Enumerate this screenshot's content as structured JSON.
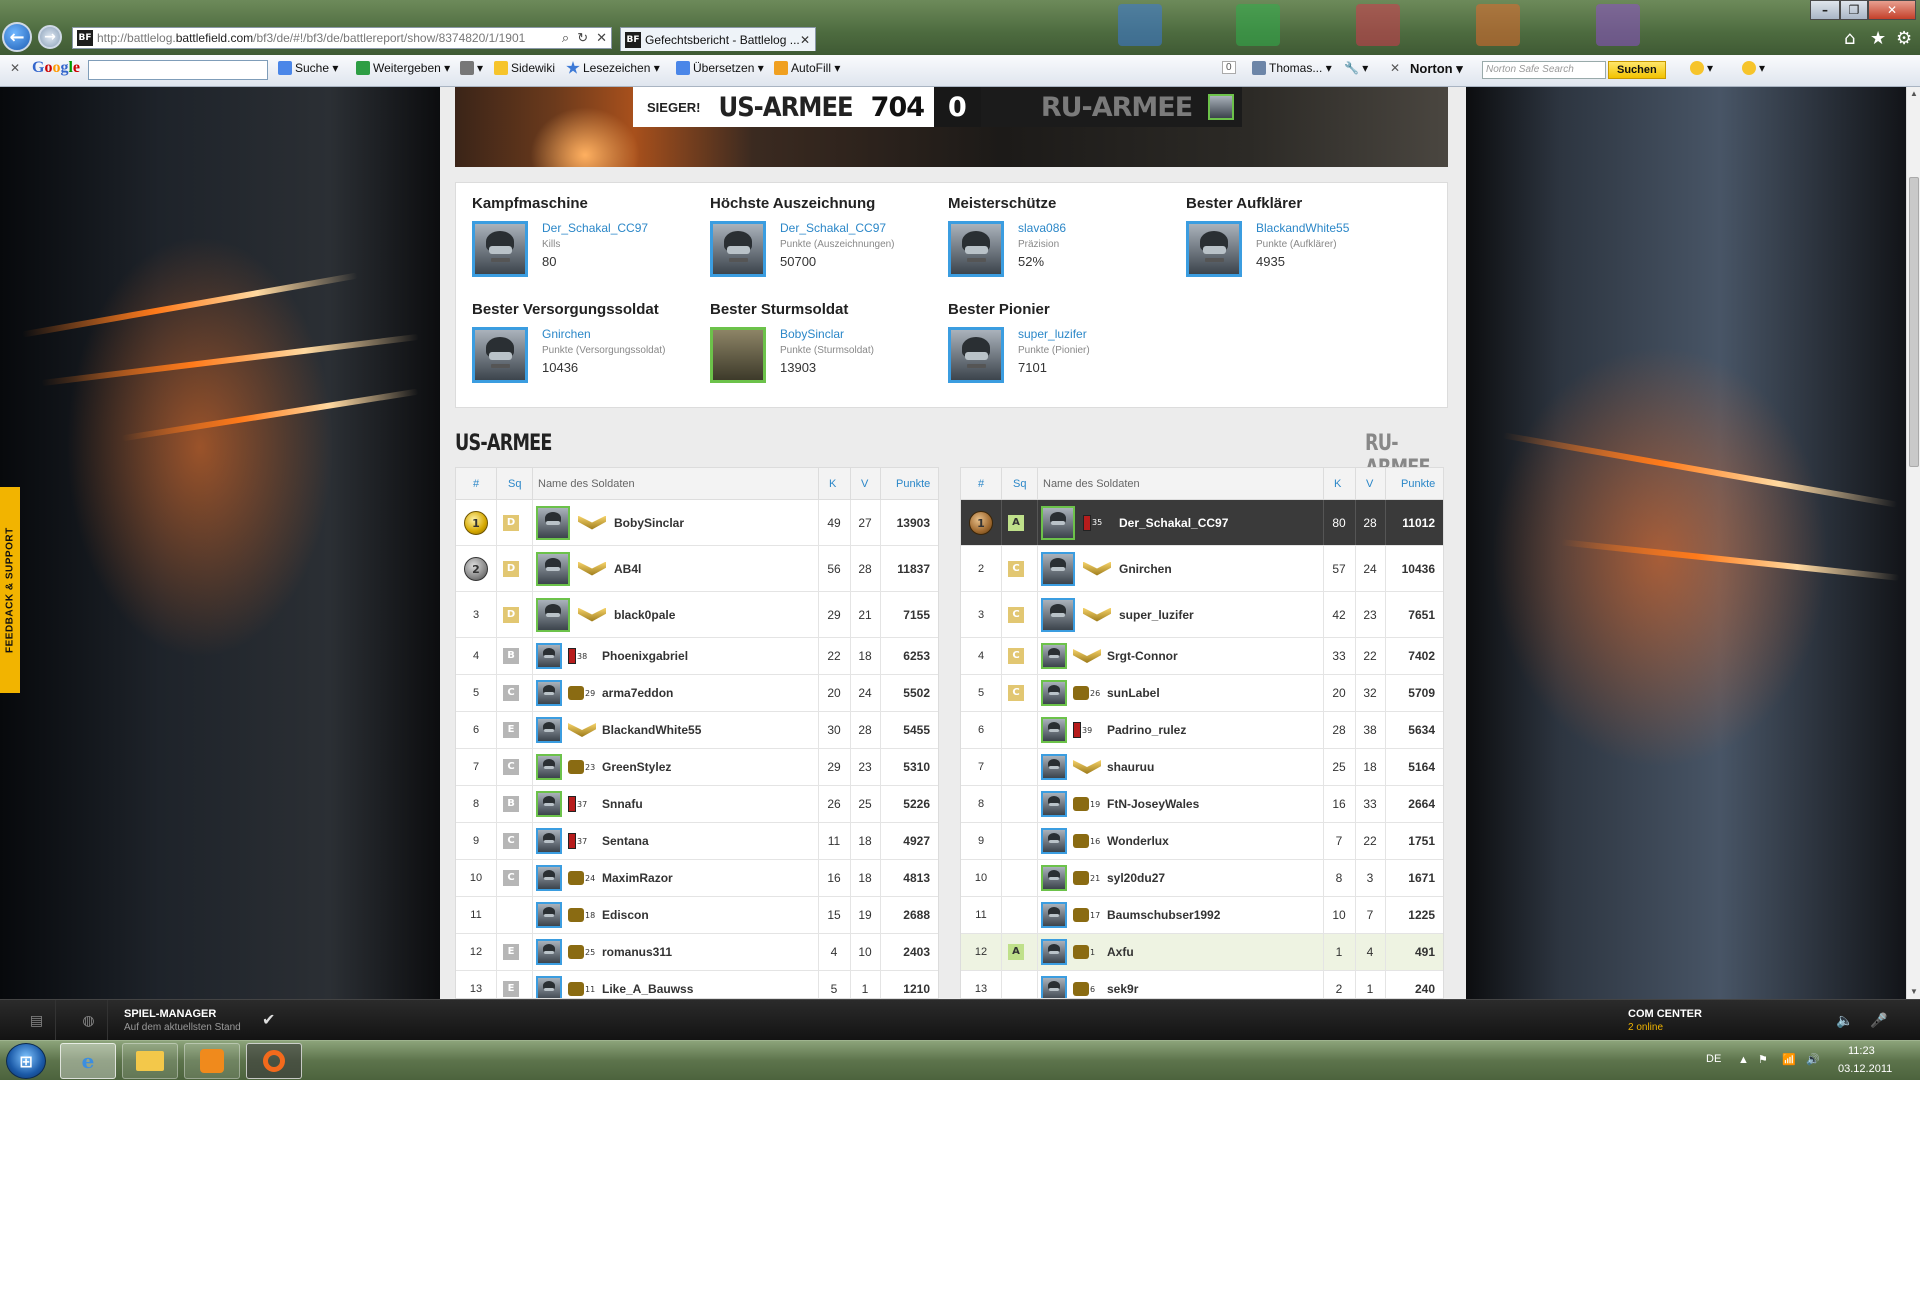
{
  "browser": {
    "url_prefix": "http://battlelog.",
    "url_host": "battlefield.com",
    "url_path": "/bf3/de/#!/bf3/de/battlereport/show/8374820/1/1901",
    "tab_title": "Gefechtsbericht - Battlelog ...",
    "favicon": "BF"
  },
  "toolbar": {
    "google_logo": "Google",
    "suche": "Suche",
    "weitergeben": "Weitergeben",
    "sidewiki": "Sidewiki",
    "lesezeichen": "Lesezeichen",
    "uebersetzen": "Übersetzen",
    "autofill": "AutoFill",
    "count": "0",
    "user": "Thomas...",
    "norton": "Norton",
    "norton_placeholder": "Norton Safe Search",
    "norton_button": "Suchen"
  },
  "scoreboard": {
    "winner_label": "SIEGER!",
    "team_a": "US-ARMEE",
    "score_a": "704",
    "score_b": "0",
    "team_b": "RU-ARMEE"
  },
  "awards": [
    {
      "title": "Kampfmaschine",
      "name": "Der_Schakal_CC97",
      "label": "Kills",
      "value": "80"
    },
    {
      "title": "Höchste Auszeichnung",
      "name": "Der_Schakal_CC97",
      "label": "Punkte (Auszeichnungen)",
      "value": "50700"
    },
    {
      "title": "Meisterschütze",
      "name": "slava086",
      "label": "Präzision",
      "value": "52%"
    },
    {
      "title": "Bester Aufklärer",
      "name": "BlackandWhite55",
      "label": "Punkte (Aufklärer)",
      "value": "4935"
    },
    {
      "title": "Bester Versorgungssoldat",
      "name": "Gnirchen",
      "label": "Punkte (Versorgungssoldat)",
      "value": "10436"
    },
    {
      "title": "Bester Sturmsoldat",
      "name": "BobySinclar",
      "label": "Punkte (Sturmsoldat)",
      "value": "13903"
    },
    {
      "title": "Bester Pionier",
      "name": "super_luzifer",
      "label": "Punkte (Pionier)",
      "value": "7101"
    }
  ],
  "teams": {
    "us_title": "US-ARMEE",
    "ru_title": "RU-ARMEE",
    "columns": {
      "rank": "#",
      "squad": "Sq",
      "name": "Name des Soldaten",
      "kills": "K",
      "deaths": "V",
      "points": "Punkte"
    }
  },
  "us_rows": [
    {
      "rank": "1",
      "squad": "D",
      "name": "BobySinclar",
      "rk": "",
      "k": "49",
      "v": "27",
      "p": "13903"
    },
    {
      "rank": "2",
      "squad": "D",
      "name": "AB4l",
      "rk": "",
      "k": "56",
      "v": "28",
      "p": "11837"
    },
    {
      "rank": "3",
      "squad": "D",
      "name": "black0pale",
      "rk": "",
      "k": "29",
      "v": "21",
      "p": "7155"
    },
    {
      "rank": "4",
      "squad": "B",
      "name": "Phoenixgabriel",
      "rk": "38",
      "k": "22",
      "v": "18",
      "p": "6253"
    },
    {
      "rank": "5",
      "squad": "C",
      "name": "arma7eddon",
      "rk": "29",
      "k": "20",
      "v": "24",
      "p": "5502"
    },
    {
      "rank": "6",
      "squad": "E",
      "name": "BlackandWhite55",
      "rk": "",
      "k": "30",
      "v": "28",
      "p": "5455"
    },
    {
      "rank": "7",
      "squad": "C",
      "name": "GreenStylez",
      "rk": "23",
      "k": "29",
      "v": "23",
      "p": "5310"
    },
    {
      "rank": "8",
      "squad": "B",
      "name": "Snnafu",
      "rk": "37",
      "k": "26",
      "v": "25",
      "p": "5226"
    },
    {
      "rank": "9",
      "squad": "C",
      "name": "Sentana",
      "rk": "37",
      "k": "11",
      "v": "18",
      "p": "4927"
    },
    {
      "rank": "10",
      "squad": "C",
      "name": "MaximRazor",
      "rk": "24",
      "k": "16",
      "v": "18",
      "p": "4813"
    },
    {
      "rank": "11",
      "squad": "",
      "name": "Ediscon",
      "rk": "18",
      "k": "15",
      "v": "19",
      "p": "2688"
    },
    {
      "rank": "12",
      "squad": "E",
      "name": "romanus311",
      "rk": "25",
      "k": "4",
      "v": "10",
      "p": "2403"
    },
    {
      "rank": "13",
      "squad": "E",
      "name": "Like_A_Bauwss",
      "rk": "11",
      "k": "5",
      "v": "1",
      "p": "1210"
    }
  ],
  "ru_rows": [
    {
      "rank": "1",
      "squad": "A",
      "name": "Der_Schakal_CC97",
      "rk": "35",
      "k": "80",
      "v": "28",
      "p": "11012"
    },
    {
      "rank": "2",
      "squad": "C",
      "name": "Gnirchen",
      "rk": "",
      "k": "57",
      "v": "24",
      "p": "10436"
    },
    {
      "rank": "3",
      "squad": "C",
      "name": "super_luzifer",
      "rk": "",
      "k": "42",
      "v": "23",
      "p": "7651"
    },
    {
      "rank": "4",
      "squad": "C",
      "name": "Srgt-Connor",
      "rk": "",
      "k": "33",
      "v": "22",
      "p": "7402"
    },
    {
      "rank": "5",
      "squad": "C",
      "name": "sunLabel",
      "rk": "26",
      "k": "20",
      "v": "32",
      "p": "5709"
    },
    {
      "rank": "6",
      "squad": "",
      "name": "Padrino_rulez",
      "rk": "39",
      "k": "28",
      "v": "38",
      "p": "5634"
    },
    {
      "rank": "7",
      "squad": "",
      "name": "shauruu",
      "rk": "",
      "k": "25",
      "v": "18",
      "p": "5164"
    },
    {
      "rank": "8",
      "squad": "",
      "name": "FtN-JoseyWales",
      "rk": "19",
      "k": "16",
      "v": "33",
      "p": "2664"
    },
    {
      "rank": "9",
      "squad": "",
      "name": "Wonderlux",
      "rk": "16",
      "k": "7",
      "v": "22",
      "p": "1751"
    },
    {
      "rank": "10",
      "squad": "",
      "name": "syl20du27",
      "rk": "21",
      "k": "8",
      "v": "3",
      "p": "1671"
    },
    {
      "rank": "11",
      "squad": "",
      "name": "Baumschubser1992",
      "rk": "17",
      "k": "10",
      "v": "7",
      "p": "1225"
    },
    {
      "rank": "12",
      "squad": "A",
      "name": "Axfu",
      "rk": "1",
      "k": "1",
      "v": "4",
      "p": "491"
    },
    {
      "rank": "13",
      "squad": "",
      "name": "sek9r",
      "rk": "6",
      "k": "2",
      "v": "1",
      "p": "240"
    }
  ],
  "feedback": "FEEDBACK & SUPPORT",
  "gamebar": {
    "title": "SPIEL-MANAGER",
    "subtitle": "Auf dem aktuellsten Stand",
    "com_title": "COM CENTER",
    "com_sub": "2 online"
  },
  "taskbar": {
    "lang": "DE",
    "time": "11:23",
    "date": "03.12.2011"
  }
}
